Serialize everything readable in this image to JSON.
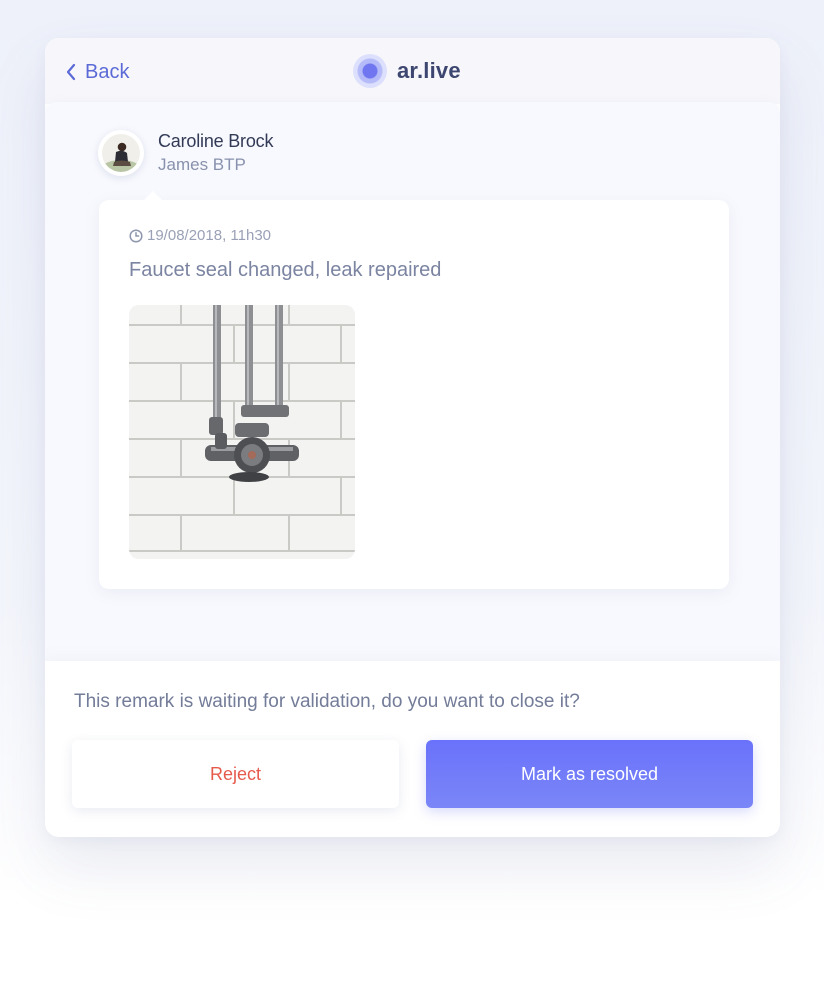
{
  "header": {
    "back_label": "Back",
    "brand_name": "ar.live",
    "back_icon": "chevron-left-icon",
    "logo_icon": "ar-live-logo"
  },
  "remark": {
    "author": {
      "name": "Caroline Brock",
      "company": "James BTP"
    },
    "timestamp": "19/08/2018, 11h30",
    "message": "Faucet seal changed, leak repaired"
  },
  "validation": {
    "prompt": "This remark is waiting for validation, do you want to close it?",
    "reject_label": "Reject",
    "resolve_label": "Mark as resolved"
  },
  "colors": {
    "accent": "#6a72fb",
    "reject": "#e65a4c",
    "brand_text": "#3d4670"
  }
}
